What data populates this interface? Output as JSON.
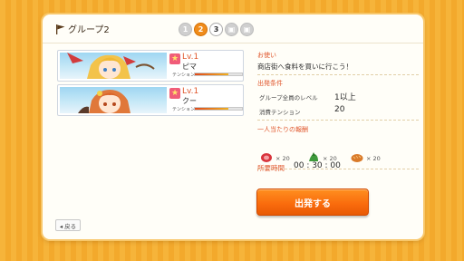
{
  "header": {
    "group_title": "グループ2",
    "pages": [
      "1",
      "2",
      "3",
      "",
      ""
    ],
    "active_page": "2"
  },
  "characters": [
    {
      "level": "Lv.1",
      "name": "ピマ",
      "tension_label": "テンション",
      "tension": 0.72
    },
    {
      "level": "Lv.1",
      "name": "クー",
      "tension_label": "テンション",
      "tension": 0.72
    }
  ],
  "mission": {
    "type_label": "お使い",
    "description": "商店街へ食料を買いに行こう！",
    "conditions_label": "出発条件",
    "cond1_label": "グループ全員のレベル",
    "cond1_value": "1以上",
    "cond2_label": "消費テンション",
    "cond2_value": "20",
    "rewards_label": "一人当たりの報酬",
    "rewards": [
      {
        "icon": "meat-icon",
        "value": "× 20"
      },
      {
        "icon": "vegetable-icon",
        "value": "× 20"
      },
      {
        "icon": "bread-icon",
        "value": "× 20"
      }
    ],
    "time_label": "所要時間",
    "time_value": "00 : 30 : 00"
  },
  "buttons": {
    "depart": "出発する",
    "back": "◂ 戻る"
  },
  "colors": {
    "accent": "#f96a0c",
    "label_red": "#e0572d",
    "background": "#f6b43a"
  }
}
